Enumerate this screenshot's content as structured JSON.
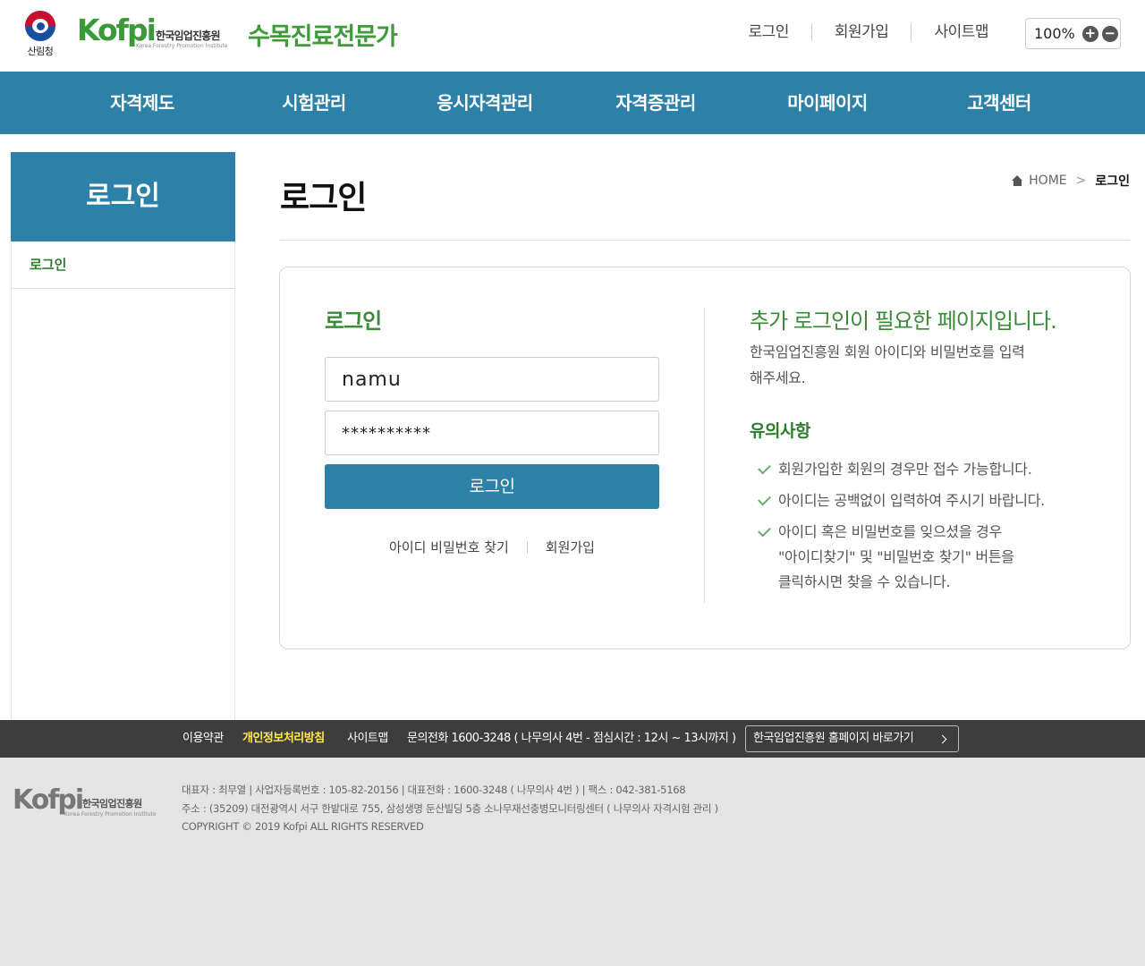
{
  "header": {
    "gov_label": "산림청",
    "logo_word": "Kofpi",
    "logo_ko": "한국임업진흥원",
    "logo_en": "Korea Forestry Promotion Institute",
    "site_title": "수목진료전문가",
    "util_links": [
      "로그인",
      "회원가입",
      "사이트맵"
    ],
    "zoom": "100%",
    "zoom_in": "+",
    "zoom_out": "−"
  },
  "gnb": [
    "자격제도",
    "시험관리",
    "응시자격관리",
    "자격증관리",
    "마이페이지",
    "고객센터"
  ],
  "lnb": {
    "title": "로그인",
    "items": [
      "로그인"
    ]
  },
  "content": {
    "page_title": "로그인",
    "breadcrumb": {
      "home": "HOME",
      "current": "로그인"
    }
  },
  "login": {
    "heading": "로그인",
    "id_value": "namu",
    "pw_value": "**********",
    "button": "로그인",
    "find_link": "아이디 비밀번호 찾기",
    "join_link": "회원가입"
  },
  "info": {
    "heading": "추가 로그인이 필요한 페이지입니다.",
    "desc": "한국임업진흥원 회원 아이디와 비밀번호를 입력해주세요.",
    "notice_heading": "유의사항",
    "notices": [
      "회원가입한 회원의 경우만 접수 가능합니다.",
      "아이디는 공백없이 입력하여 주시기 바랍니다.",
      "아이디 혹은 비밀번호를 잊으셨을 경우 \"아이디찾기\" 및 \"비밀번호 찾기\" 버튼을 클릭하시면 찾을 수 있습니다."
    ]
  },
  "footer": {
    "links": [
      "이용약관",
      "개인정보처리방침",
      "사이트맵",
      "문의전화 1600-3248 ( 나무의사 4번 - 점심시간 : 12시 ~ 13시까지 )"
    ],
    "home_link": "한국임업진흥원 홈페이지 바로가기",
    "info_lines": [
      "대표자 : 최무열 | 사업자등록번호 : 105-82-20156 | 대표전화 : 1600-3248 ( 나무의사 4번 ) | 팩스 : 042-381-5168",
      "주소 : (35209) 대전광역시 서구 한밭대로 755, 삼성생명 둔산빌딩 5층 소나무재선충병모니터링센터 ( 나무의사 자격시험 관리 )",
      "COPYRIGHT © 2019 Kofpi ALL RIGHTS RESERVED"
    ],
    "logo_word": "Kofpi",
    "logo_ko": "한국임업진흥원",
    "logo_en": "Korea Forestry Promotion Institute"
  },
  "colors": {
    "primary_blue": "#2d80a7",
    "brand_green": "#3f9b3a",
    "footer_dark": "#3d3d3d",
    "footer_light": "#e4e4e4",
    "highlight_yellow": "#ffe94a"
  }
}
